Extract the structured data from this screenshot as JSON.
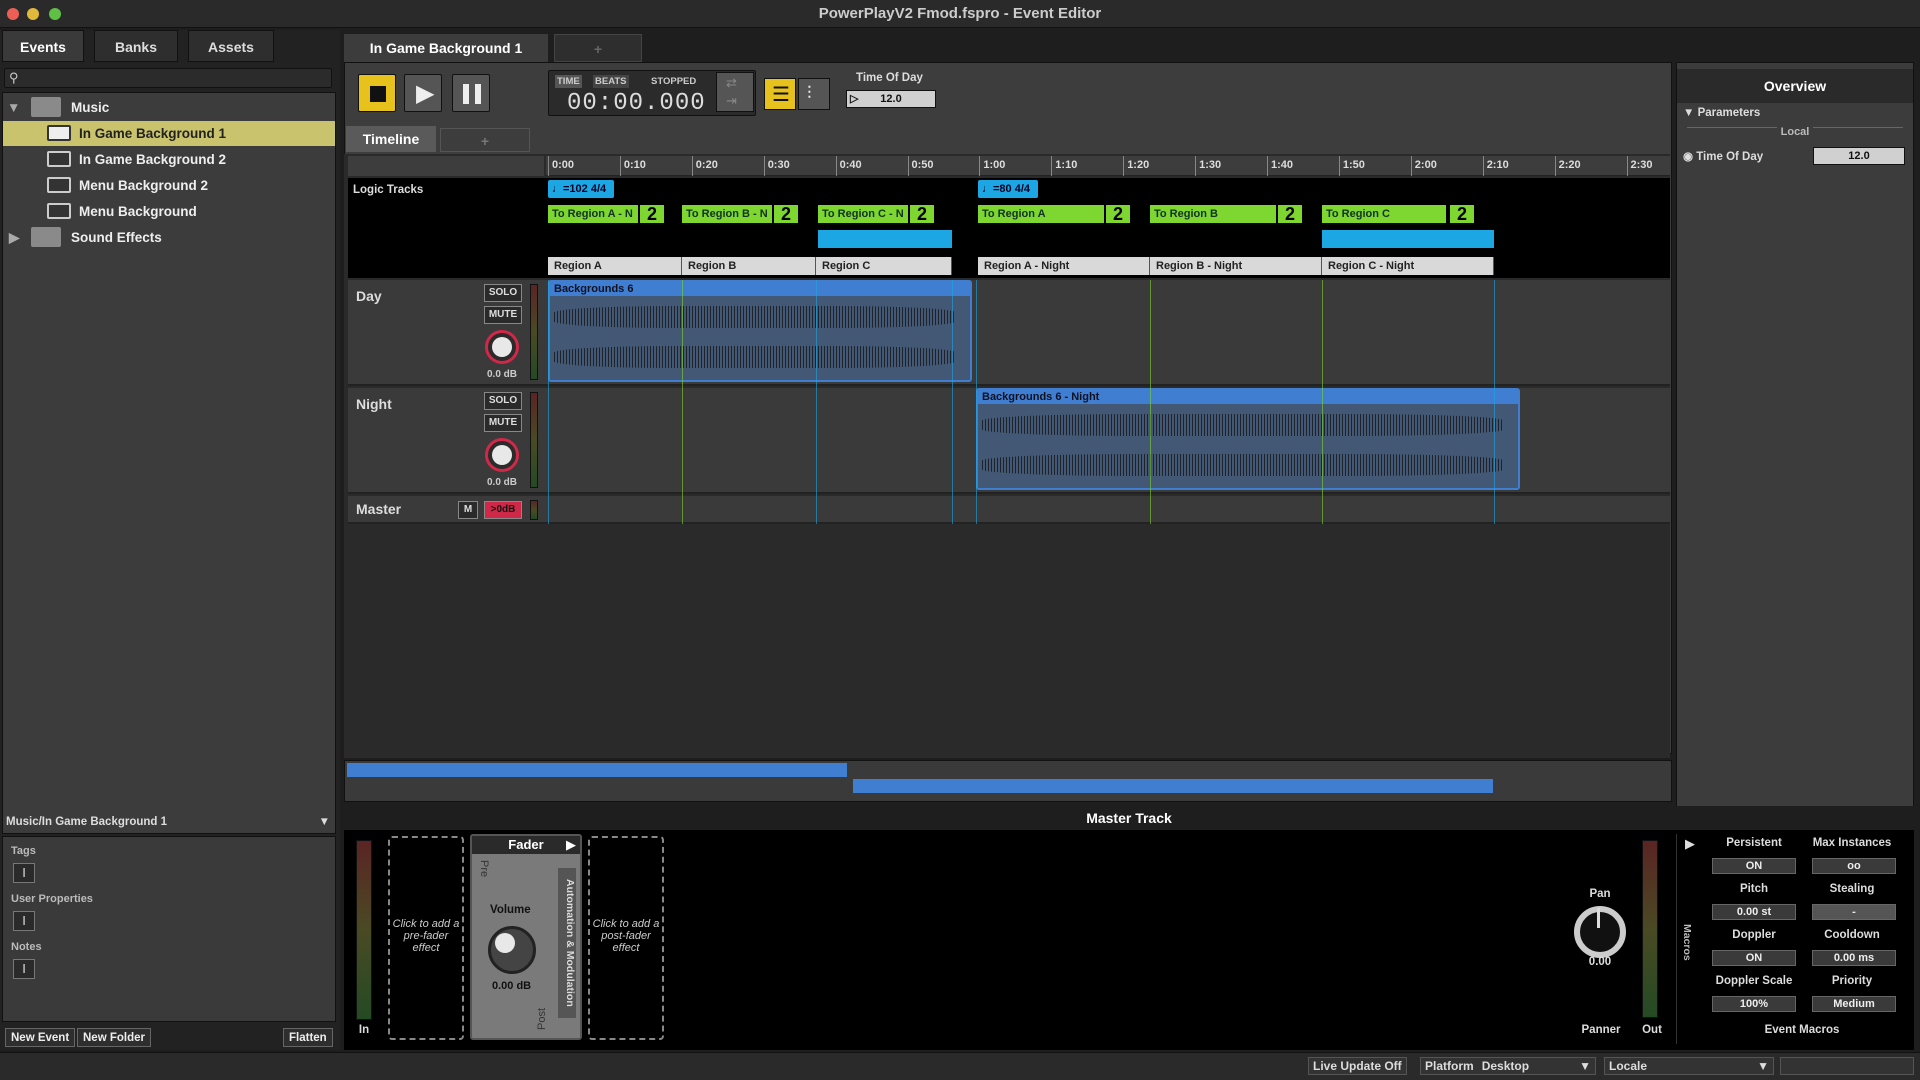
{
  "window": {
    "title": "PowerPlayV2 Fmod.fspro - Event Editor"
  },
  "browser": {
    "tabs": [
      "Events",
      "Banks",
      "Assets"
    ],
    "tree": [
      {
        "label": "Music",
        "type": "folder"
      },
      {
        "label": "In Game Background 1",
        "type": "event",
        "selected": true
      },
      {
        "label": "In Game Background 2",
        "type": "event"
      },
      {
        "label": "Menu Background 2",
        "type": "event"
      },
      {
        "label": "Menu Background",
        "type": "event"
      },
      {
        "label": "Sound Effects",
        "type": "folder"
      }
    ],
    "path": "Music/In Game Background 1",
    "props": {
      "tags": "Tags",
      "user_properties": "User Properties",
      "notes": "Notes",
      "text_icon": "I"
    },
    "buttons": {
      "new_event": "New Event",
      "new_folder": "New Folder",
      "flatten": "Flatten"
    }
  },
  "editor": {
    "tab": "In Game Background 1",
    "add_tab": "+",
    "transport": {
      "time_label": "TIME",
      "beats_label": "BEATS",
      "state": "STOPPED",
      "time": "00:00.000"
    },
    "param": {
      "label": "Time Of Day",
      "value": "12.0"
    },
    "subtabs": {
      "timeline": "Timeline",
      "add": "+"
    },
    "ruler": [
      "0:00",
      "0:10",
      "0:20",
      "0:30",
      "0:40",
      "0:50",
      "1:00",
      "1:10",
      "1:20",
      "1:30",
      "1:40",
      "1:50",
      "2:00",
      "2:10",
      "2:20",
      "2:30"
    ],
    "logic_tracks_label": "Logic Tracks",
    "tempo": [
      "=102 4/4",
      "=80 4/4"
    ],
    "transitions": [
      "To Region A - N",
      "To Region B - N",
      "To Region C - N",
      "To Region A",
      "To Region B",
      "To Region C"
    ],
    "transition_count": "2",
    "regions": [
      "Region A",
      "Region B",
      "Region C",
      "Region A - Night",
      "Region B - Night",
      "Region C - Night"
    ],
    "tracks": [
      {
        "name": "Day",
        "solo": "SOLO",
        "mute": "MUTE",
        "db": "0.0 dB",
        "clip": "Backgrounds 6"
      },
      {
        "name": "Night",
        "solo": "SOLO",
        "mute": "MUTE",
        "db": "0.0 dB",
        "clip": "Backgrounds 6 - Night"
      }
    ],
    "master": {
      "name": "Master",
      "m": "M",
      "db": ">0dB"
    }
  },
  "overview": {
    "title": "Overview",
    "parameters": "Parameters",
    "local": "Local",
    "param_label": "Time Of Day",
    "param_value": "12.0"
  },
  "master_track": {
    "title": "Master Track",
    "in": "In",
    "out": "Out",
    "pre_slot": "Click to add a pre-fader effect",
    "post_slot": "Click to add a post-fader effect",
    "fader": "Fader",
    "pre": "Pre",
    "post": "Post",
    "volume": "Volume",
    "volume_value": "0.00 dB",
    "automation": "Automation & Modulation",
    "pan": "Pan",
    "pan_value": "0.00",
    "panner": "Panner",
    "macros_side": "Macros",
    "macros": {
      "persistent": "Persistent",
      "persistent_value": "ON",
      "max_instances": "Max Instances",
      "max_instances_value": "oo",
      "pitch": "Pitch",
      "pitch_value": "0.00 st",
      "stealing": "Stealing",
      "stealing_value": "-",
      "doppler": "Doppler",
      "doppler_value": "ON",
      "cooldown": "Cooldown",
      "cooldown_value": "0.00 ms",
      "doppler_scale": "Doppler Scale",
      "doppler_scale_value": "100%",
      "priority": "Priority",
      "priority_value": "Medium",
      "footer": "Event Macros"
    }
  },
  "status": {
    "live_update": "Live Update Off",
    "platform_label": "Platform",
    "platform_value": "Desktop",
    "locale_label": "Locale",
    "locale_value": ""
  },
  "colors": {
    "accent_yellow": "#e8c21c",
    "selected_row": "#c9c36e",
    "tempo_blue": "#1da6e4",
    "transition_green": "#7ed631",
    "clip_blue": "#3f7ed0",
    "knob_red": "#d02848"
  }
}
